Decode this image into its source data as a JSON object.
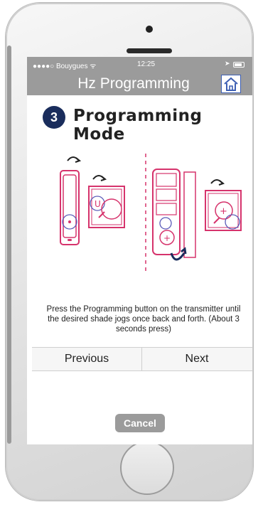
{
  "status_bar": {
    "carrier": "●●●●○ Bouygues ᯤ",
    "time": "12:25",
    "location_icon": "location-arrow-icon",
    "battery_icon": "battery-icon"
  },
  "nav": {
    "title": "Hz Programming",
    "home_icon": "home-icon"
  },
  "step": {
    "number": "3",
    "title": "Programming Mode"
  },
  "illustration": {
    "label_icon": "remote-programming-illustration",
    "accent_color": "#d6336c",
    "secondary_color": "#5a5ab8"
  },
  "instructions": "Press the Programming button on the transmitter until the desired shade jogs once back and forth. (About 3 seconds press)",
  "buttons": {
    "previous": "Previous",
    "next": "Next",
    "cancel": "Cancel"
  },
  "colors": {
    "header_gray": "#9b9b9b",
    "step_circle": "#1a2d5c",
    "home_icon_border": "#3d5fb3"
  }
}
